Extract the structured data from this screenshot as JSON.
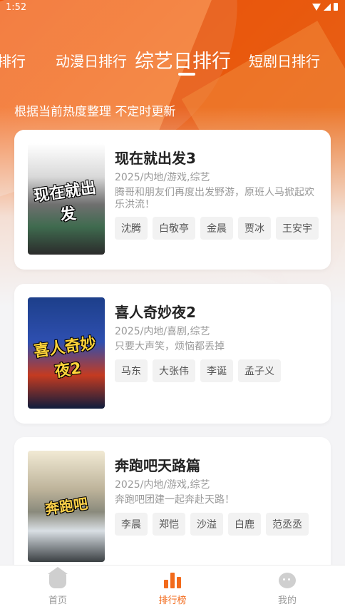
{
  "status": {
    "time": "1:52"
  },
  "tabs": [
    {
      "label": "排行"
    },
    {
      "label": "动漫日排行"
    },
    {
      "label": "综艺日排行"
    },
    {
      "label": "短剧日排行"
    }
  ],
  "active_tab": "综艺日排行",
  "subtitle": "根据当前热度整理 不定时更新",
  "cards": [
    {
      "poster_text": "现在就出发",
      "title": "现在就出发3",
      "meta": "2025/内地/游戏,综艺",
      "desc": "腾哥和朋友们再度出发野游，原班人马掀起欢乐洪流！",
      "cast": [
        "沈腾",
        "白敬亭",
        "金晨",
        "贾冰",
        "王安宇"
      ]
    },
    {
      "poster_text": "喜人奇妙夜2",
      "title": "喜人奇妙夜2",
      "meta": "2025/内地/喜剧,综艺",
      "desc": "只要大声笑，烦恼都丢掉",
      "cast": [
        "马东",
        "大张伟",
        "李诞",
        "孟子义"
      ]
    },
    {
      "poster_text": "奔跑吧",
      "title": "奔跑吧天路篇",
      "meta": "2025/内地/游戏,综艺",
      "desc": "奔跑吧团建一起奔赴天路！",
      "cast": [
        "李晨",
        "郑恺",
        "沙溢",
        "白鹿",
        "范丞丞"
      ]
    }
  ],
  "nav": [
    {
      "label": "首页",
      "icon": "home-icon"
    },
    {
      "label": "排行榜",
      "icon": "rank-icon"
    },
    {
      "label": "我的",
      "icon": "profile-icon"
    }
  ],
  "colors": {
    "accent": "#f26a1b",
    "hero": "#f2560c"
  }
}
